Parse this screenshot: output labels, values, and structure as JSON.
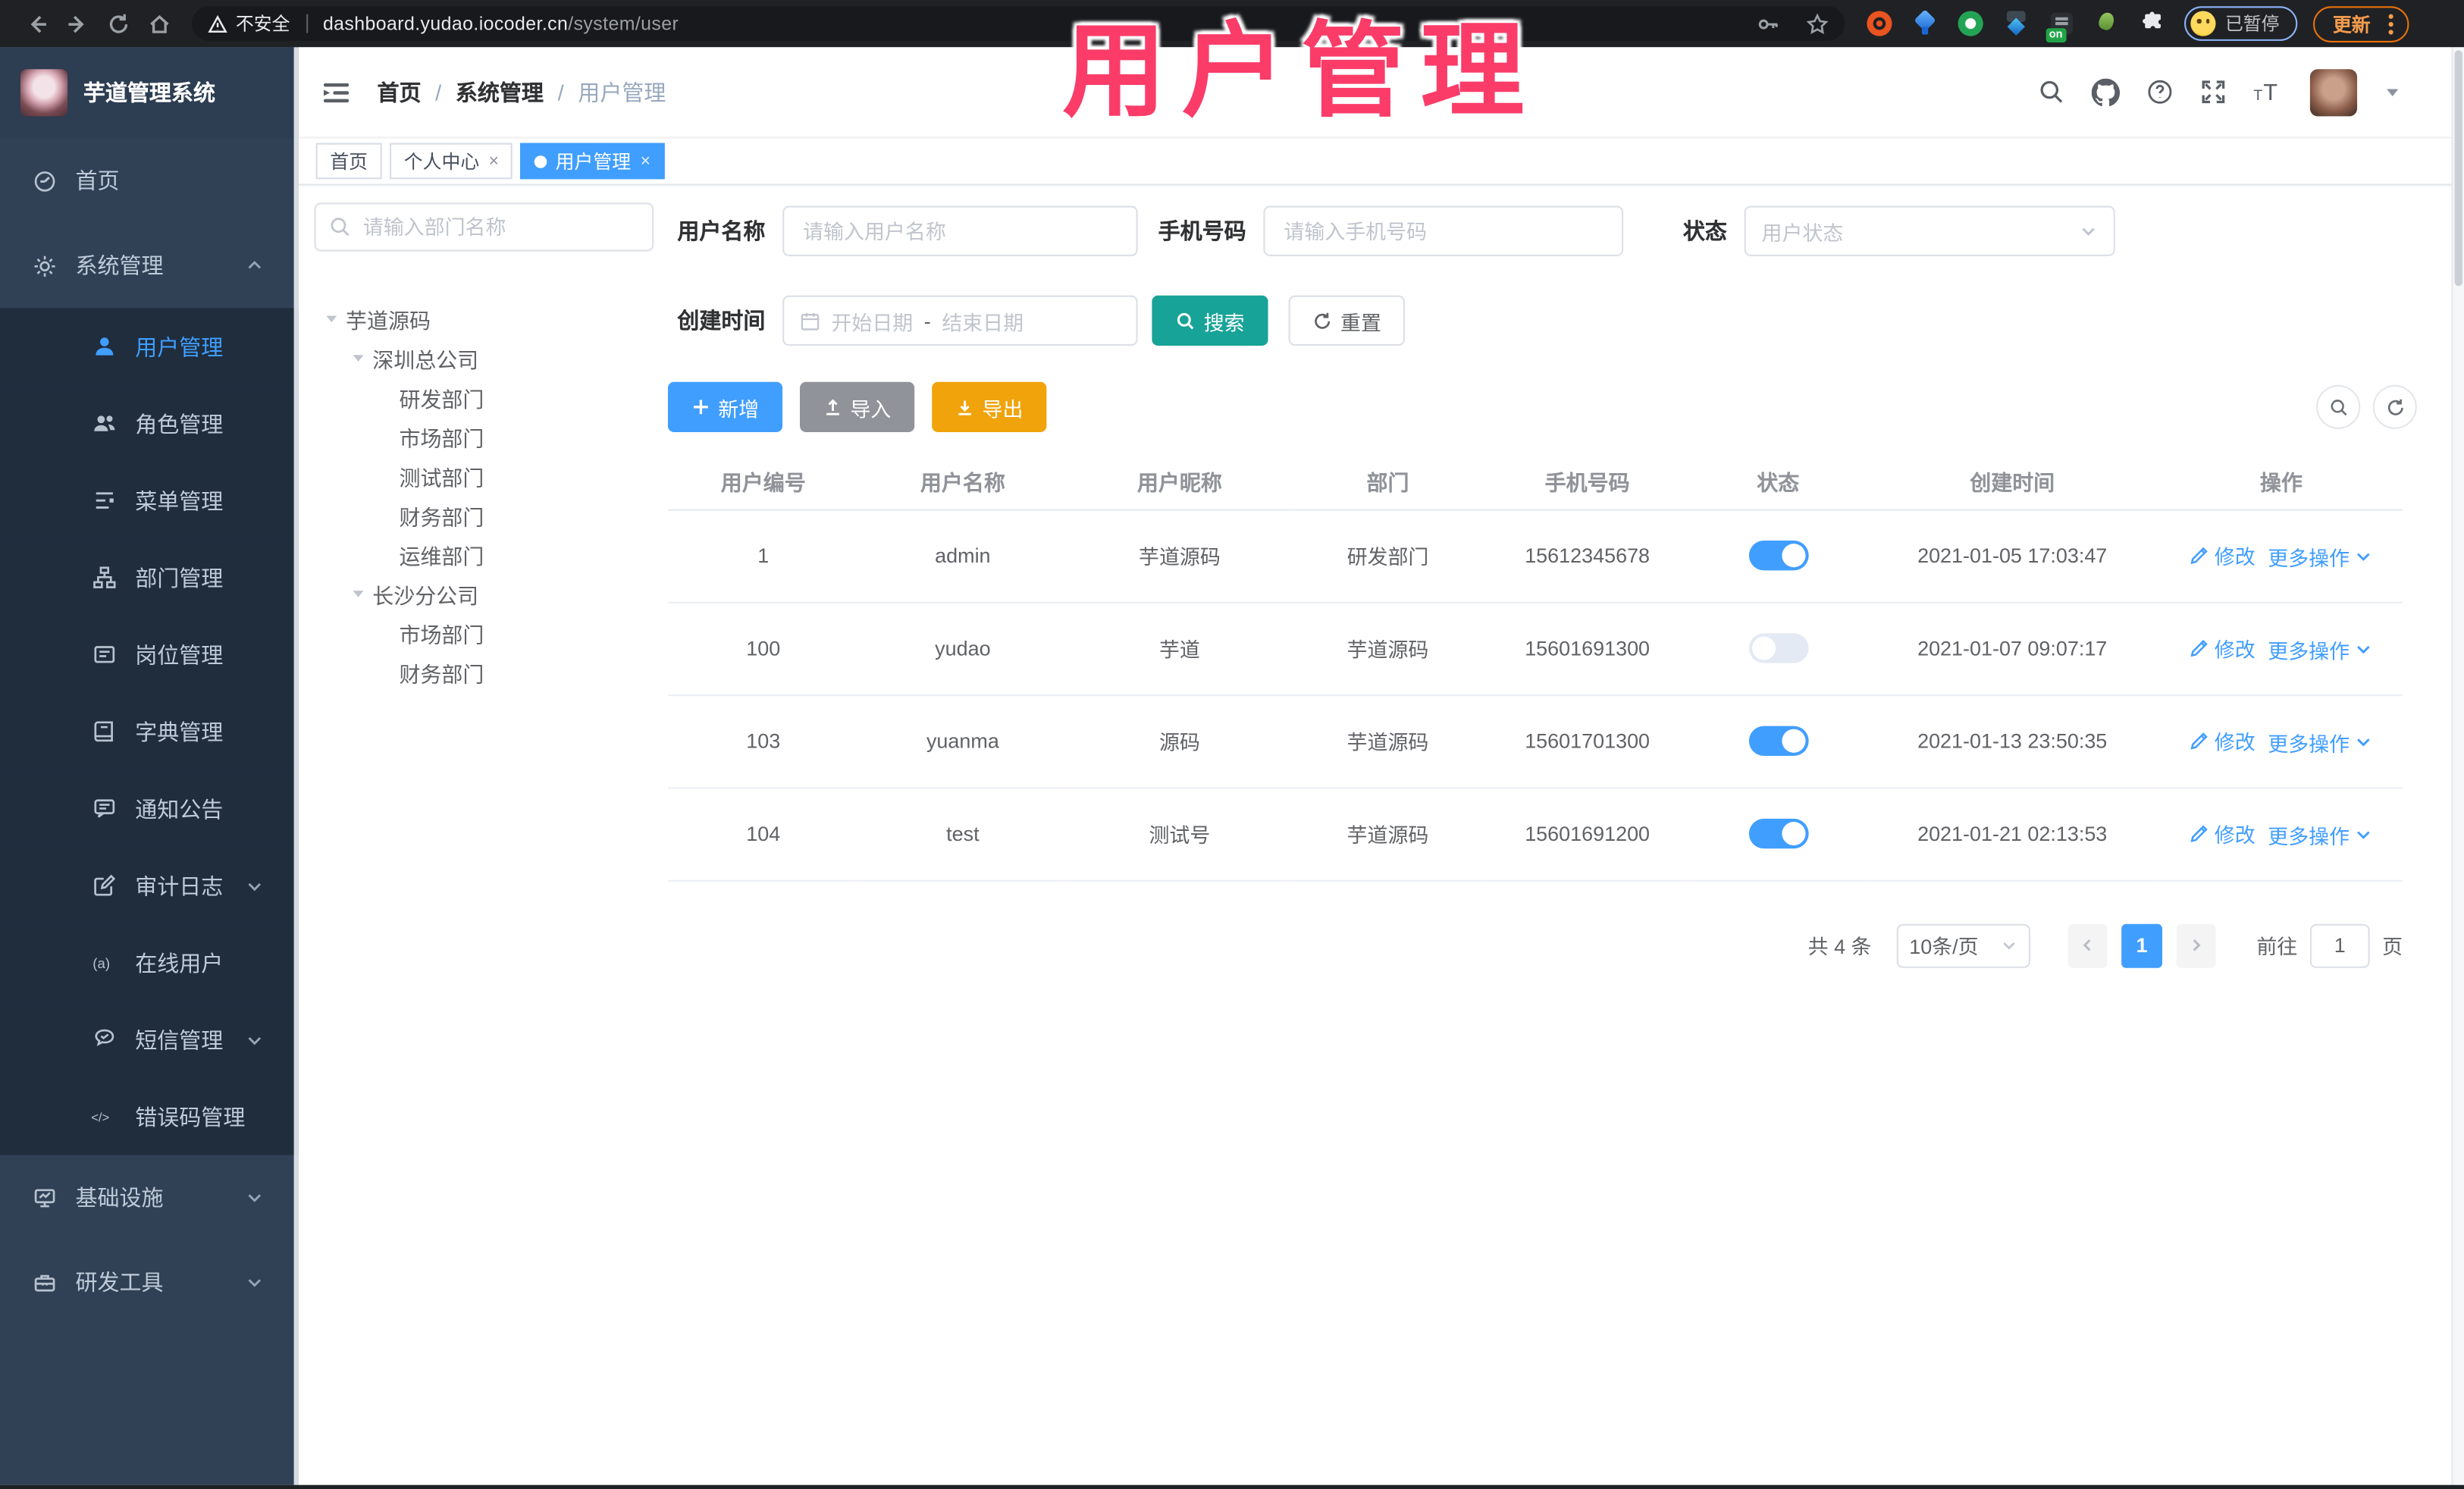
{
  "browser": {
    "security_label": "不安全",
    "url_host": "dashboard.yudao.iocoder.cn",
    "url_path": "/system/user",
    "extension_badge": "on",
    "paused_badge": "已暂停",
    "update_button": "更新"
  },
  "overlay": {
    "title": "用户管理"
  },
  "app": {
    "logo_title": "芋道管理系统",
    "breadcrumb": [
      "首页",
      "系统管理",
      "用户管理"
    ],
    "tags": [
      {
        "label": "首页",
        "closable": false,
        "active": false
      },
      {
        "label": "个人中心",
        "closable": true,
        "active": false
      },
      {
        "label": "用户管理",
        "closable": true,
        "active": true
      }
    ]
  },
  "sidebar": {
    "items": [
      {
        "key": "home",
        "icon": "dashboard-icon",
        "label": "首页",
        "sub": false
      },
      {
        "key": "system",
        "icon": "gear-icon",
        "label": "系统管理",
        "sub": false,
        "arrow": "up"
      },
      {
        "key": "user",
        "icon": "user-icon",
        "label": "用户管理",
        "sub": true,
        "active": true
      },
      {
        "key": "role",
        "icon": "peoples-icon",
        "label": "角色管理",
        "sub": true
      },
      {
        "key": "menu",
        "icon": "tree-table-icon",
        "label": "菜单管理",
        "sub": true
      },
      {
        "key": "dept",
        "icon": "tree-icon",
        "label": "部门管理",
        "sub": true
      },
      {
        "key": "post",
        "icon": "post-icon",
        "label": "岗位管理",
        "sub": true
      },
      {
        "key": "dict",
        "icon": "dict-icon",
        "label": "字典管理",
        "sub": true
      },
      {
        "key": "notice",
        "icon": "message-icon",
        "label": "通知公告",
        "sub": true
      },
      {
        "key": "audit-log",
        "icon": "edit-square-icon",
        "label": "审计日志",
        "sub": true,
        "arrow": "down"
      },
      {
        "key": "online-user",
        "icon": "online-icon",
        "label": "在线用户",
        "sub": true
      },
      {
        "key": "sms",
        "icon": "sms-icon",
        "label": "短信管理",
        "sub": true,
        "arrow": "down"
      },
      {
        "key": "error-code",
        "icon": "code-icon",
        "label": "错误码管理",
        "sub": true
      },
      {
        "key": "infra",
        "icon": "monitor-icon",
        "label": "基础设施",
        "sub": false,
        "arrow": "down"
      },
      {
        "key": "dev-tools",
        "icon": "toolbox-icon",
        "label": "研发工具",
        "sub": false,
        "arrow": "down"
      }
    ]
  },
  "dept_panel": {
    "search_placeholder": "请输入部门名称",
    "tree": [
      {
        "label": "芋道源码",
        "children": [
          {
            "label": "深圳总公司",
            "children": [
              {
                "label": "研发部门"
              },
              {
                "label": "市场部门"
              },
              {
                "label": "测试部门"
              },
              {
                "label": "财务部门"
              },
              {
                "label": "运维部门"
              }
            ]
          },
          {
            "label": "长沙分公司",
            "children": [
              {
                "label": "市场部门"
              },
              {
                "label": "财务部门"
              }
            ]
          }
        ]
      }
    ]
  },
  "filters": {
    "username_label": "用户名称",
    "username_placeholder": "请输入用户名称",
    "mobile_label": "手机号码",
    "mobile_placeholder": "请输入手机号码",
    "status_label": "状态",
    "status_placeholder": "用户状态",
    "create_time_label": "创建时间",
    "date_start_placeholder": "开始日期",
    "date_separator": "-",
    "date_end_placeholder": "结束日期",
    "search_button": "搜索",
    "reset_button": "重置"
  },
  "toolbar": {
    "add": "新增",
    "import": "导入",
    "export": "导出"
  },
  "table": {
    "columns": [
      "用户编号",
      "用户名称",
      "用户昵称",
      "部门",
      "手机号码",
      "状态",
      "创建时间",
      "操作"
    ],
    "rows": [
      {
        "id": "1",
        "username": "admin",
        "nickname": "芋道源码",
        "dept": "研发部门",
        "mobile": "15612345678",
        "status": true,
        "created": "2021-01-05 17:03:47"
      },
      {
        "id": "100",
        "username": "yudao",
        "nickname": "芋道",
        "dept": "芋道源码",
        "mobile": "15601691300",
        "status": false,
        "created": "2021-01-07 09:07:17"
      },
      {
        "id": "103",
        "username": "yuanma",
        "nickname": "源码",
        "dept": "芋道源码",
        "mobile": "15601701300",
        "status": true,
        "created": "2021-01-13 23:50:35"
      },
      {
        "id": "104",
        "username": "test",
        "nickname": "测试号",
        "dept": "芋道源码",
        "mobile": "15601691200",
        "status": true,
        "created": "2021-01-21 02:13:53"
      }
    ],
    "actions": {
      "edit": "修改",
      "more": "更多操作"
    }
  },
  "pagination": {
    "total_text": "共 4 条",
    "page_size": "10条/页",
    "current_page": "1",
    "goto_label": "前往",
    "goto_value": "1",
    "page_unit": "页"
  },
  "colors": {
    "accent_blue": "#409eff",
    "teal_search": "#18a398",
    "warning_yellow": "#f0a30a",
    "info_grey": "#909399",
    "sidebar_bg": "#304156",
    "submenu_bg": "#1f2d3d",
    "sidebar_text": "#bfcbd9",
    "overlay_pink": "#fb3c69",
    "chrome_bar": "#202124",
    "update_orange": "#e8710a",
    "paused_blue_border": "#8ab4f8"
  }
}
